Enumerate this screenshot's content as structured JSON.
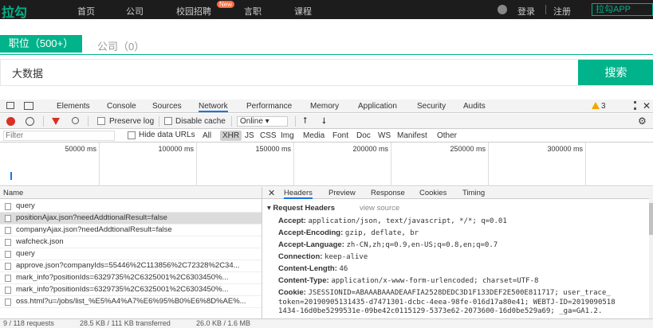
{
  "site": {
    "logo": "拉勾",
    "nav": [
      "首页",
      "公司",
      "校园招聘",
      "言职",
      "课程"
    ],
    "new_badge": "New",
    "login": "登录",
    "register": "注册",
    "recruit_entry": "拉勾APP"
  },
  "tabs": {
    "positions": "职位（500+）",
    "companies": "公司（0）"
  },
  "search": {
    "value": "大数据",
    "button": "搜索"
  },
  "devtools": {
    "panels": [
      "Elements",
      "Console",
      "Sources",
      "Network",
      "Performance",
      "Memory",
      "Application",
      "Security",
      "Audits"
    ],
    "active_panel": "Network",
    "warning_count": "3",
    "toolbar": {
      "preserve_log": "Preserve log",
      "disable_cache": "Disable cache",
      "throttle": "Online"
    },
    "filter": {
      "placeholder": "Filter",
      "hide_data_urls": "Hide data URLs",
      "types": [
        "All",
        "XHR",
        "JS",
        "CSS",
        "Img",
        "Media",
        "Font",
        "Doc",
        "WS",
        "Manifest",
        "Other"
      ],
      "active_type": "XHR"
    },
    "timeline_ticks": [
      "50000 ms",
      "100000 ms",
      "150000 ms",
      "200000 ms",
      "250000 ms",
      "300000 ms"
    ],
    "request_list": {
      "header": "Name",
      "rows": [
        "query",
        "positionAjax.json?needAddtionalResult=false",
        "companyAjax.json?needAddtionalResult=false",
        "wafcheck.json",
        "query",
        "approve.json?companyIds=55446%2C113856%2C72328%2C34...",
        "mark_info?positionIds=6329735%2C6325001%2C6303450%...",
        "mark_info?positionIds=6329735%2C6325001%2C6303450%...",
        "oss.html?u=/jobs/list_%E5%A4%A7%E6%95%B0%E6%8D%AE%..."
      ],
      "selected_index": 1
    },
    "detail": {
      "tabs": [
        "Headers",
        "Preview",
        "Response",
        "Cookies",
        "Timing"
      ],
      "active_tab": "Headers",
      "section": "Request Headers",
      "view_source": "view source",
      "headers": [
        {
          "k": "Accept:",
          "v": "application/json, text/javascript, */*; q=0.01"
        },
        {
          "k": "Accept-Encoding:",
          "v": "gzip, deflate, br"
        },
        {
          "k": "Accept-Language:",
          "v": "zh-CN,zh;q=0.9,en-US;q=0.8,en;q=0.7"
        },
        {
          "k": "Connection:",
          "v": "keep-alive"
        },
        {
          "k": "Content-Length:",
          "v": "46"
        },
        {
          "k": "Content-Type:",
          "v": "application/x-www-form-urlencoded; charset=UTF-8"
        },
        {
          "k": "Cookie:",
          "v": "JSESSIONID=ABAAABAAADEAAFIA2528DEDC3D1F133DEF2E500E811717; user_trace_"
        }
      ],
      "cookie_cont": [
        "token=20190905131435-d7471301-dcbc-4eea-98fe-016d17a80e41; WEBTJ-ID=2019090518",
        "1434-16d0be5299531e-09be42c0115129-5373e62-2073600-16d0be529a69; _ga=GA1.2.",
        "..."
      ]
    },
    "status": {
      "requests": "9 / 118 requests",
      "transferred": "28.5 KB / 111 KB transferred",
      "resources": "26.0 KB / 1.6 MB"
    }
  }
}
